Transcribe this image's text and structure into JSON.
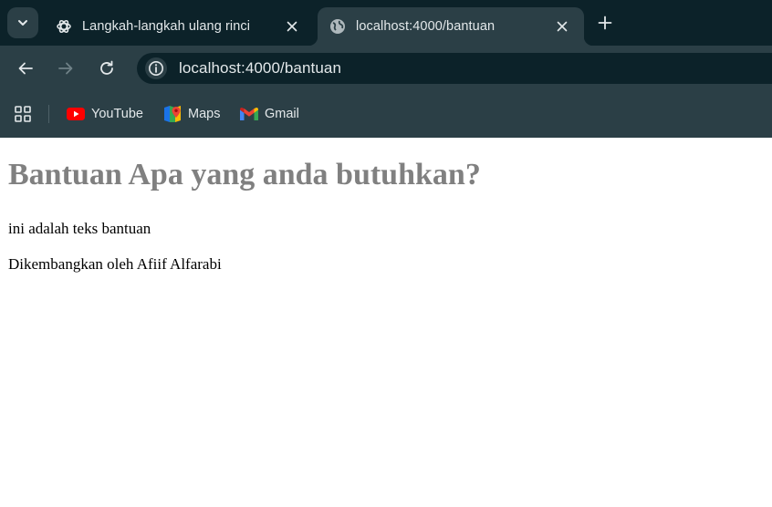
{
  "browser": {
    "tabs": [
      {
        "title": "Langkah-langkah ulang rinci",
        "favicon": "chatgpt-icon",
        "active": false
      },
      {
        "title": "localhost:4000/bantuan",
        "favicon": "globe-icon",
        "active": true
      }
    ],
    "address_bar": {
      "url": "localhost:4000/bantuan"
    },
    "bookmarks": [
      {
        "label": "YouTube",
        "icon": "youtube-icon"
      },
      {
        "label": "Maps",
        "icon": "maps-icon"
      },
      {
        "label": "Gmail",
        "icon": "gmail-icon"
      }
    ],
    "colors": {
      "frame": "#0c2229",
      "toolbar": "#2b3f46",
      "text": "#e3e8ea"
    }
  },
  "page": {
    "heading": "Bantuan Apa yang anda butuhkan?",
    "paragraphs": [
      "ini adalah teks bantuan",
      "Dikembangkan oleh Afiif Alfarabi"
    ],
    "colors": {
      "heading": "#808080",
      "text": "#000000"
    }
  }
}
